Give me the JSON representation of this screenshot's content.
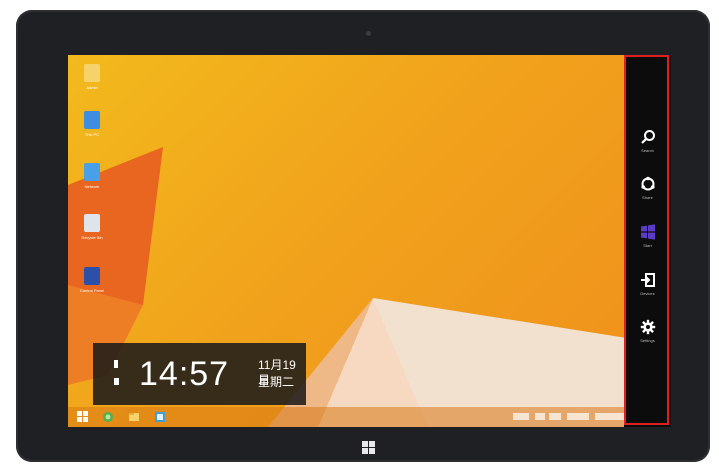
{
  "desktop": {
    "icons": [
      {
        "icon": "folder-icon",
        "label": "Admin"
      },
      {
        "icon": "computer-icon",
        "label": "This PC"
      },
      {
        "icon": "network-icon",
        "label": "Network"
      },
      {
        "icon": "recycle-bin-icon",
        "label": "Recycle Bin"
      },
      {
        "icon": "control-panel-icon",
        "label": "Control Panel"
      }
    ]
  },
  "clock": {
    "time": "14:57",
    "date": "11月19日",
    "weekday": "星期二"
  },
  "charms": [
    {
      "icon": "search-icon",
      "label": "Search"
    },
    {
      "icon": "share-icon",
      "label": "Share"
    },
    {
      "icon": "start-icon",
      "label": "Start"
    },
    {
      "icon": "devices-icon",
      "label": "Devices"
    },
    {
      "icon": "settings-icon",
      "label": "Settings"
    }
  ],
  "taskbar": {
    "items": [
      "start-button-icon",
      "ie-icon",
      "explorer-icon",
      "store-icon"
    ]
  },
  "colors": {
    "accent_charm_start": "#5b3cc4",
    "highlight_border": "#e02020",
    "wallpaper_yellow": "#f2ba1c",
    "wallpaper_orange": "#e8661f"
  }
}
